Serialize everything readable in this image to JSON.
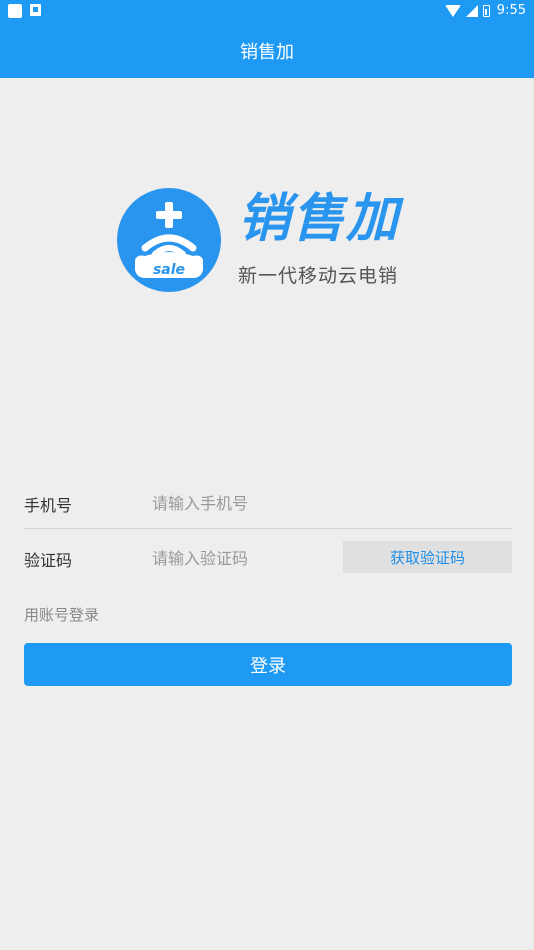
{
  "status_bar": {
    "time": "9:55"
  },
  "app_bar": {
    "title": "销售加"
  },
  "brand": {
    "logo_text": "sale",
    "title": "销售加",
    "subtitle": "新一代移动云电销",
    "primary_color": "#2a95ee"
  },
  "form": {
    "phone_label": "手机号",
    "phone_placeholder": "请输入手机号",
    "phone_value": "",
    "code_label": "验证码",
    "code_placeholder": "请输入验证码",
    "code_value": "",
    "get_code_label": "获取验证码"
  },
  "alt_login_label": "用账号登录",
  "login_label": "登录",
  "colors": {
    "accent": "#1e9af5",
    "background": "#eeeeee"
  }
}
